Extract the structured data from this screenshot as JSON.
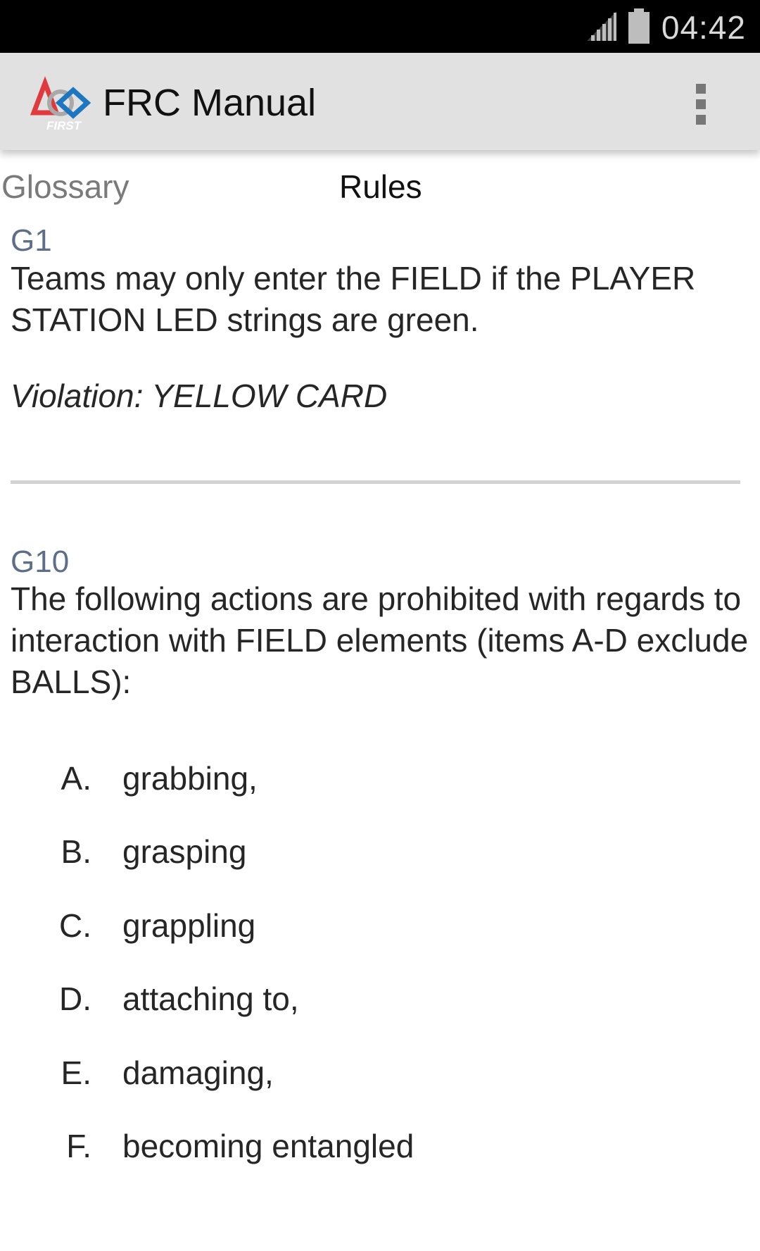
{
  "status_bar": {
    "time": "04:42",
    "signal_icon": "signal-icon",
    "battery_icon": "battery-icon"
  },
  "action_bar": {
    "logo_text": "FIRST",
    "title": "FRC Manual",
    "overflow_icon": "overflow-menu-icon"
  },
  "tabs": [
    {
      "label": "Glossary",
      "selected": false
    },
    {
      "label": "Rules",
      "selected": true
    }
  ],
  "rules": [
    {
      "id": "G1",
      "text": "Teams may only enter the FIELD if the PLAYER STATION LED strings are green.",
      "violation": "Violation: YELLOW CARD"
    },
    {
      "id": "G10",
      "text": "The following actions are prohibited with regards to interaction with FIELD elements (items A-D exclude BALLS):",
      "items": [
        {
          "marker": "A.",
          "text": "grabbing,"
        },
        {
          "marker": "B.",
          "text": "grasping"
        },
        {
          "marker": "C.",
          "text": "grappling"
        },
        {
          "marker": "D.",
          "text": "attaching to,"
        },
        {
          "marker": "E.",
          "text": "damaging,"
        },
        {
          "marker": "F.",
          "text": "becoming entangled"
        }
      ]
    }
  ],
  "colors": {
    "status_bar": "#000000",
    "action_bar": "#e1e1e1",
    "rule_id": "#5f6e88",
    "logo_red": "#e03a3e",
    "logo_blue": "#1d77c0"
  }
}
